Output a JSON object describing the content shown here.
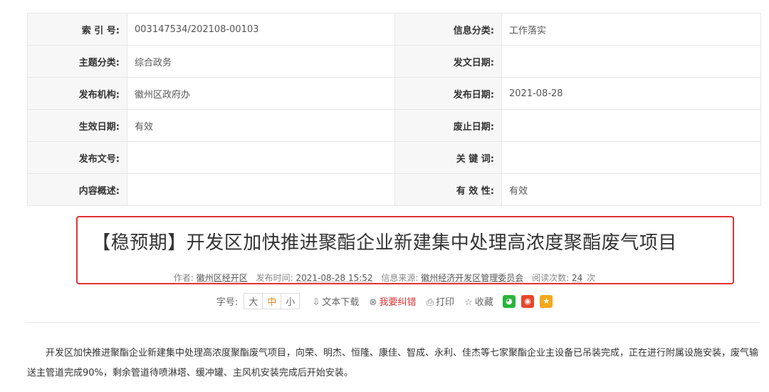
{
  "meta": {
    "rows": [
      [
        {
          "k": "索 引 号:",
          "v": "003147534/202108-00103"
        },
        {
          "k": "信息分类:",
          "v": "工作落实"
        }
      ],
      [
        {
          "k": "主题分类:",
          "v": "综合政务"
        },
        {
          "k": "发文日期:",
          "v": ""
        }
      ],
      [
        {
          "k": "发布机构:",
          "v": "徽州区政府办"
        },
        {
          "k": "发布日期:",
          "v": "2021-08-28"
        }
      ],
      [
        {
          "k": "生效日期:",
          "v": "有效"
        },
        {
          "k": "废止日期:",
          "v": ""
        }
      ],
      [
        {
          "k": "发布文号:",
          "v": ""
        },
        {
          "k": "关 键 词:",
          "v": ""
        }
      ],
      [
        {
          "k": "内容概述:",
          "v": ""
        },
        {
          "k": "有 效 性:",
          "v": "有效"
        }
      ]
    ]
  },
  "article": {
    "title": "【稳预期】开发区加快推进聚酯企业新建集中处理高浓度聚酯废气项目",
    "byline": {
      "author_label": "作者:",
      "author": "徽州区经开区",
      "time_label": "发布时间:",
      "time": "2021-08-28 15:52",
      "source_label": "信息来源:",
      "source": "徽州经济开发区管理委员会",
      "reads_label": "阅读次数:",
      "reads": "24",
      "reads_unit": "次"
    },
    "toolbar": {
      "font_label": "字号:",
      "size_large": "大",
      "size_medium": "中",
      "size_small": "小",
      "download": "文本下载",
      "report_error": "我要纠错",
      "print": "打印",
      "favorite": "收藏"
    },
    "body": "开发区加快推进聚酯企业新建集中处理高浓度聚酯废气项目，向荣、明杰、恒隆、康佳、智成、永利、佳杰等七家聚酯企业主设备已吊装完成，正在进行附属设施安装，废气输送主管道完成90%，剩余管道待喷淋塔、缓冲罐、主风机安装完成后开始安装。"
  },
  "colors": {
    "highlight_border": "#e03434",
    "active_size": "#e8862b"
  },
  "icons": [
    "download-icon",
    "report-error-icon",
    "print-icon",
    "favorite-icon",
    "wechat-share-icon",
    "weibo-share-icon",
    "qzone-share-icon"
  ]
}
